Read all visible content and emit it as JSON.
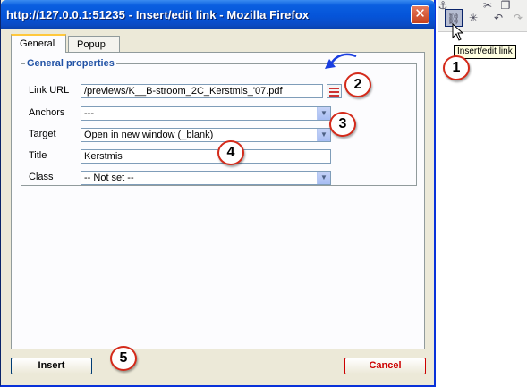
{
  "window": {
    "title": "http://127.0.0.1:51235 - Insert/edit link - Mozilla Firefox",
    "close": "✕"
  },
  "tabs": [
    {
      "label": "General"
    },
    {
      "label": "Popup"
    }
  ],
  "general": {
    "legend": "General properties",
    "link_url": {
      "label": "Link URL",
      "value": "/previews/K__B-stroom_2C_Kerstmis_'07.pdf"
    },
    "anchors": {
      "label": "Anchors",
      "value": "---"
    },
    "target": {
      "label": "Target",
      "value": "Open in new window (_blank)"
    },
    "title": {
      "label": "Title",
      "value": "Kerstmis"
    },
    "class": {
      "label": "Class",
      "value": "-- Not set --"
    }
  },
  "buttons": {
    "insert": "Insert",
    "cancel": "Cancel"
  },
  "toolbar": {
    "tooltip": "Insert/edit link",
    "icons": [
      "anchor-icon",
      "cut-icon",
      "copy-icon",
      "link-icon",
      "unlink-icon",
      "undo-icon",
      "redo-icon"
    ]
  },
  "callouts": [
    "1",
    "2",
    "3",
    "4",
    "5"
  ],
  "colors": {
    "titlebar": "#0554d9",
    "dialog_bg": "#ece9d8",
    "legend": "#2152a5",
    "callout_border": "#d42a1a",
    "cancel_text": "#cc0000"
  }
}
